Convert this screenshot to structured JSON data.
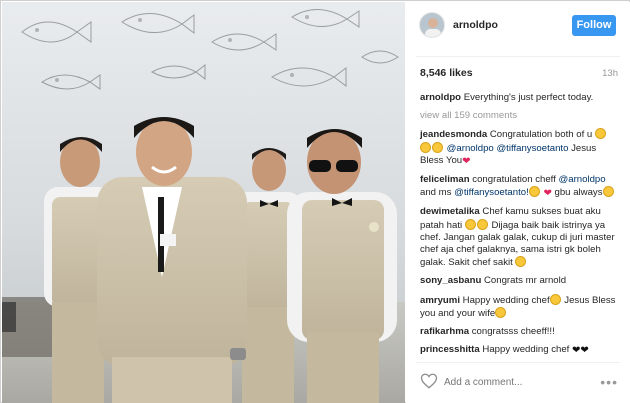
{
  "post": {
    "username": "arnoldpo",
    "follow_label": "Follow",
    "likes": "8,546 likes",
    "age": "13h",
    "caption": "Everything's just perfect today.",
    "view_all": "view all 159 comments",
    "add_comment_placeholder": "Add a comment..."
  },
  "comments": [
    {
      "user": "jeandesmonda",
      "text": "Congratulation both of u",
      "mention1": "@arnoldpo",
      "mention2": "@tiffanysoetanto",
      "text2": "Jesus Bless You"
    },
    {
      "user": "feliceliman",
      "text": "congratulation cheff",
      "mention1": "@arnoldpo",
      "text_and": "and ms",
      "mention2": "@tiffanysoetanto!",
      "text2": "gbu always"
    },
    {
      "user": "dewimetalika",
      "text": "Chef kamu sukses buat aku patah hati",
      "text2": "Dijaga baik baik istrinya ya chef. Jangan galak galak, cukup di juri master chef aja chef galaknya, sama istri gk boleh galak. Sakit chef sakit"
    },
    {
      "user": "sony_asbanu",
      "text": "Congrats mr arnold"
    },
    {
      "user": "amryumi",
      "text": "Happy wedding chef",
      "text2": "Jesus Bless you and your wife"
    },
    {
      "user": "rafikarhma",
      "text": "congratsss cheeff!!!"
    },
    {
      "user": "princesshitta",
      "text": "Happy wedding chef"
    }
  ],
  "icons": {
    "avatar": "avatar",
    "like": "heart-outline-icon",
    "more": "more-options-icon"
  },
  "colors": {
    "follow_button": "#3897f0",
    "mention": "#003569",
    "muted": "#999999"
  }
}
